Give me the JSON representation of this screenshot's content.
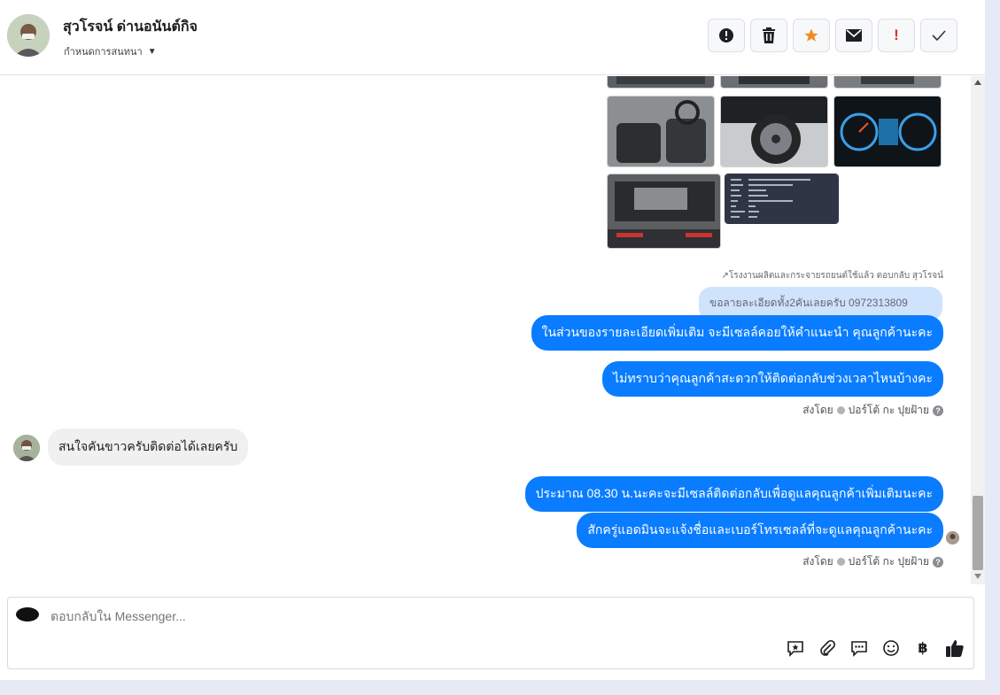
{
  "header": {
    "contact_name": "สุวโรจน์ ด่านอนันต์กิจ",
    "assign_label": "กำหนดการสนทนา",
    "actions": [
      {
        "name": "spam-icon",
        "label": "!"
      },
      {
        "name": "trash-icon",
        "label": ""
      },
      {
        "name": "star-icon",
        "label": ""
      },
      {
        "name": "mail-icon",
        "label": ""
      },
      {
        "name": "important-icon",
        "label": "!"
      },
      {
        "name": "check-icon",
        "label": ""
      }
    ]
  },
  "thread": {
    "forward_note": "โรงงานผลิตและกระจายรถยนต์ใช้แล้ว ตอบกลับ สุวโรจน์",
    "quoted_message": "ขอลายละเอียดทั้ง2คันเลยครับ 0972313809",
    "outgoing_1": "ในส่วนของรายละเอียดเพิ่มเติม จะมีเซลล์คอยให้คำแนะนำ คุณลูกค้านะคะ",
    "outgoing_2": "ไม่ทราบว่าคุณลูกค้าสะดวกให้ติดต่อกลับช่วงเวลาไหนบ้างคะ",
    "sent_by_1": {
      "prefix": "ส่งโดย",
      "name": "ปอร์โต้ กะ ปุยฝ้าย"
    },
    "incoming_1": "สนใจคันขาวครับติดต่อได้เลยครับ",
    "outgoing_3": "ประมาณ 08.30 น.นะคะจะมีเซลล์ติดต่อกลับเพื่อดูแลคุณลูกค้าเพิ่มเติมนะคะ",
    "outgoing_4": "สักครู่แอดมินจะแจ้งชื่อและเบอร์โทรเซลล์ที่จะดูแลคุณลูกค้านะคะ",
    "sent_by_2": {
      "prefix": "ส่งโดย",
      "name": "ปอร์โต้ กะ ปุยฝ้าย"
    }
  },
  "composer": {
    "placeholder": "ตอบกลับใน Messenger...",
    "currency_symbol": "฿"
  },
  "colors": {
    "accent": "#0a7cff",
    "star": "#f28b23",
    "important": "#e02f1f"
  }
}
